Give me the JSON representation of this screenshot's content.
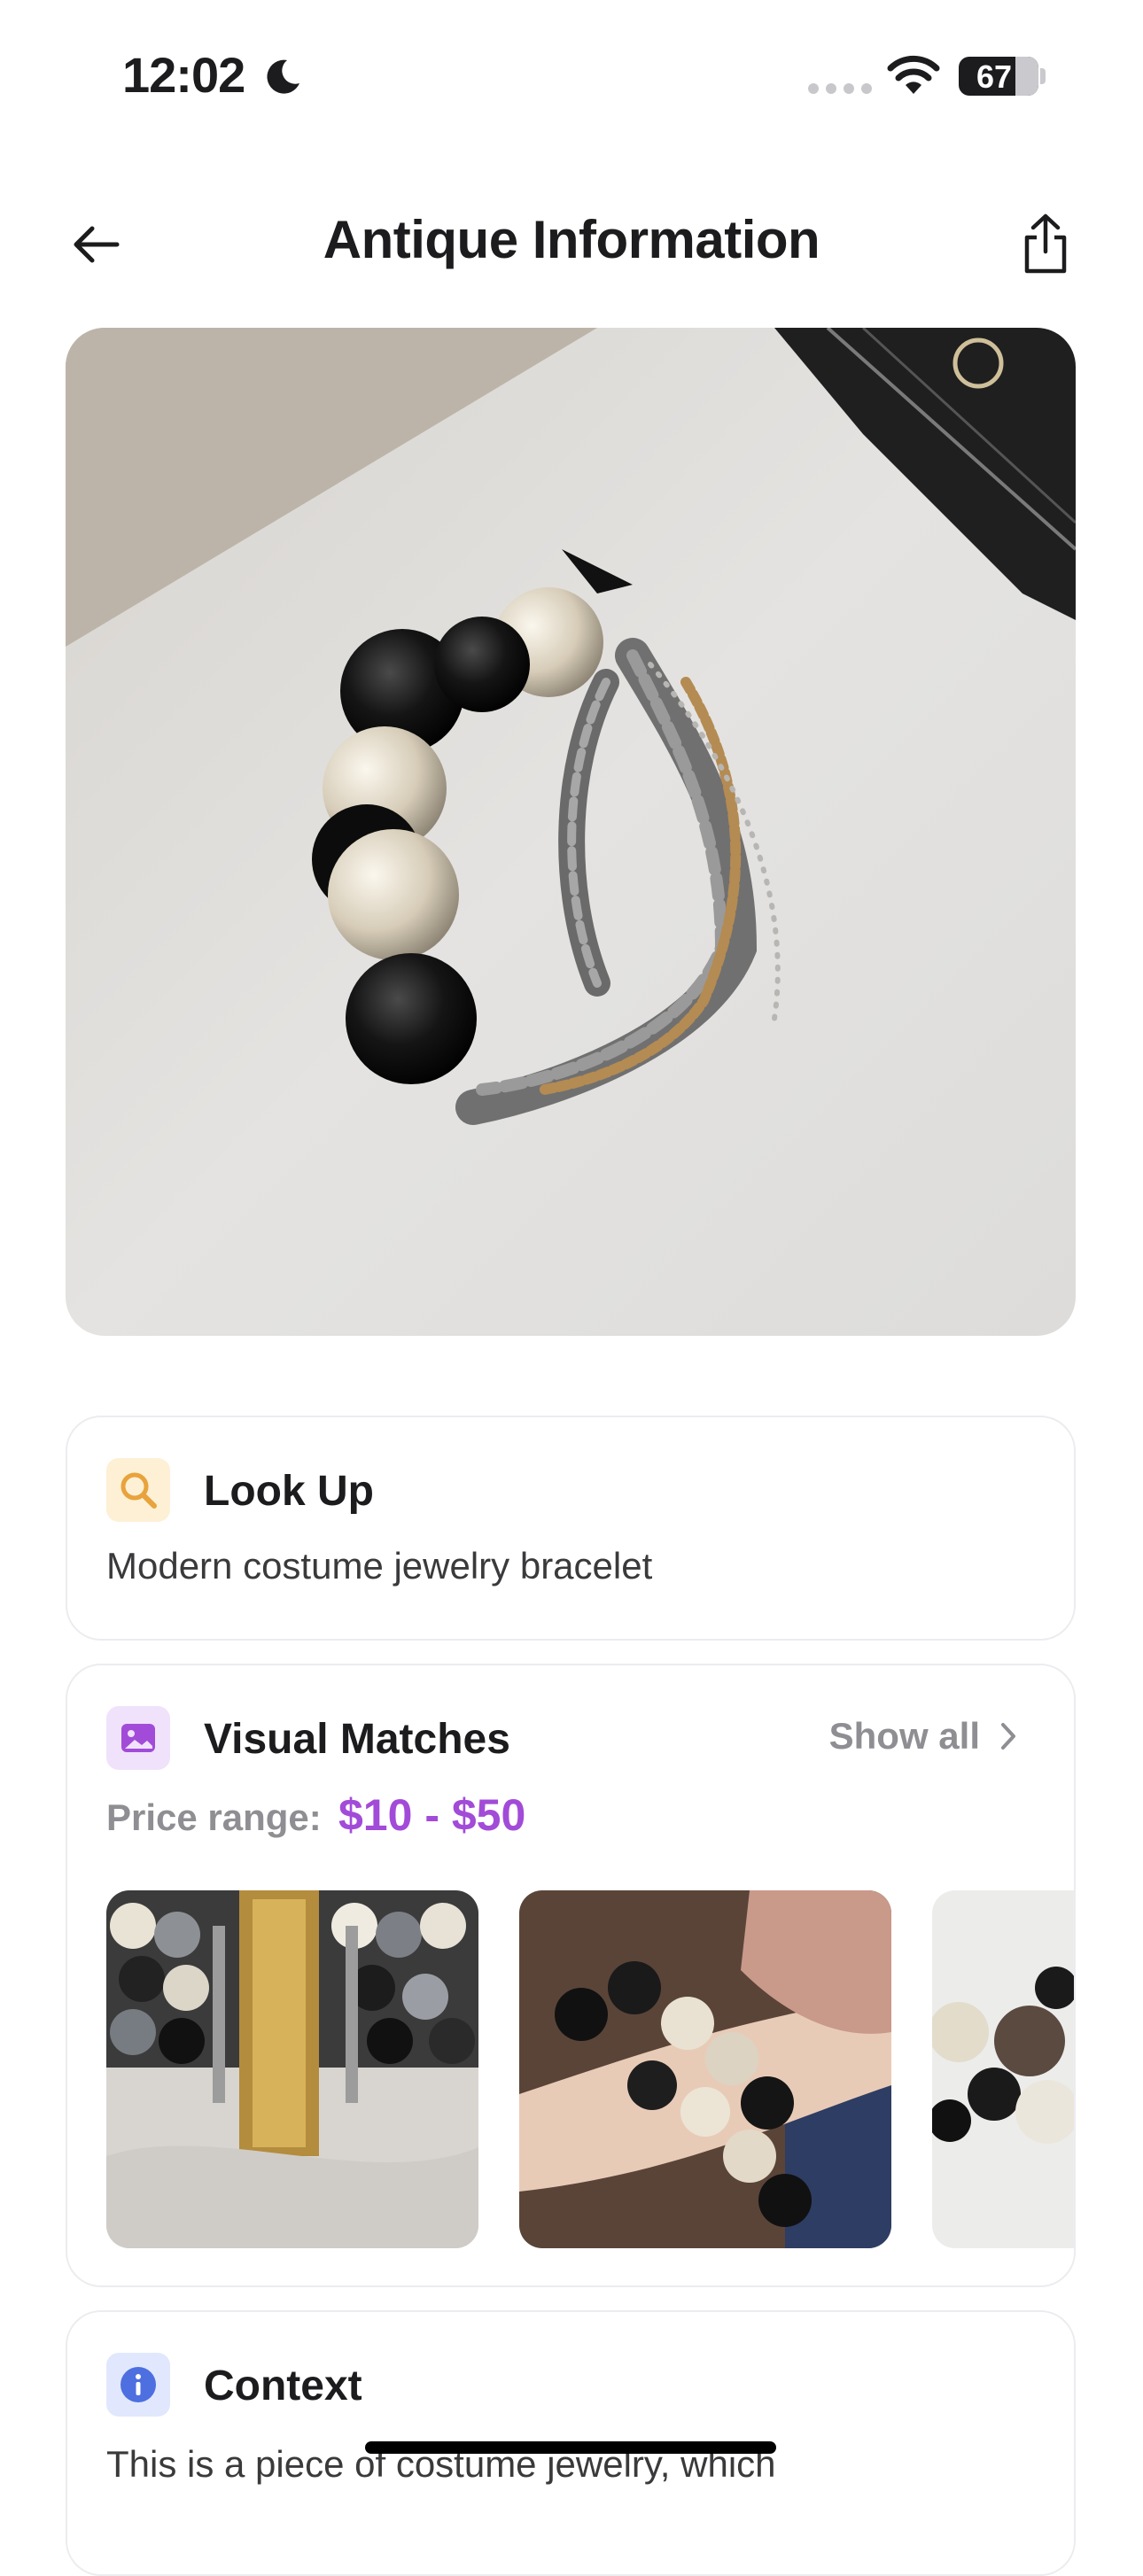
{
  "status_bar": {
    "time": "12:02",
    "battery": "67"
  },
  "header": {
    "title": "Antique Information"
  },
  "lookup": {
    "title": "Look Up",
    "text": "Modern costume jewelry bracelet"
  },
  "visual_matches": {
    "title": "Visual Matches",
    "show_all": "Show all",
    "price_label": "Price range:",
    "price_value": "$10 - $50"
  },
  "context": {
    "title": "Context",
    "text": "This is a piece of costume jewelry, which"
  },
  "colors": {
    "accent_purple": "#a24bd8",
    "lookup_icon_bg": "#fdf0d5",
    "visual_icon_bg": "#f0e2fb",
    "context_icon_bg": "#e1e8fd"
  }
}
